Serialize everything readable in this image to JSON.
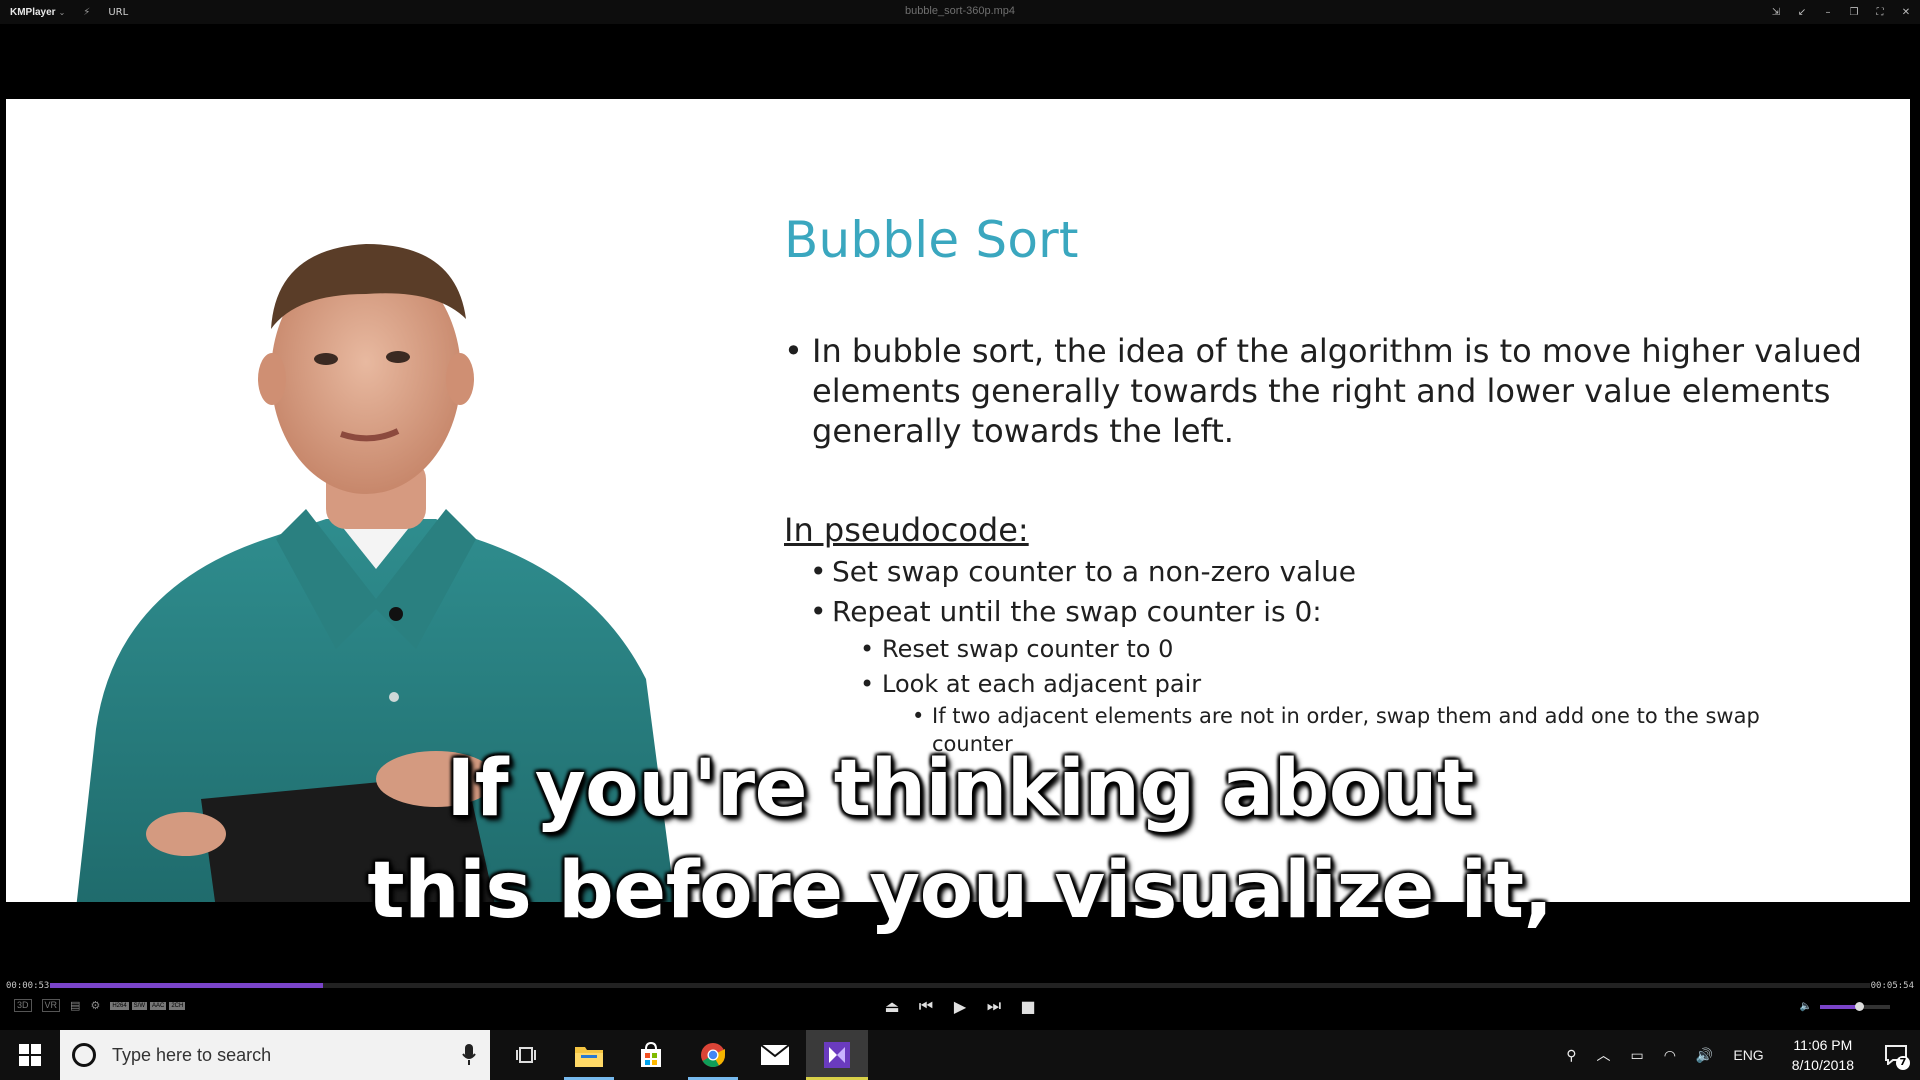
{
  "window": {
    "app_name": "KMPlayer",
    "url_label": "URL",
    "file_title": "bubble_sort-360p.mp4"
  },
  "slide": {
    "title": "Bubble Sort",
    "bullet_main_lines": [
      "In bubble sort, the idea of the algorithm is to move higher valued",
      "elements generally towards the right and lower value elements",
      "generally towards the left."
    ],
    "pseudocode_heading": "In pseudocode:",
    "items": [
      {
        "level": 1,
        "text": "Set swap counter to a non-zero value"
      },
      {
        "level": 1,
        "text": "Repeat until the swap counter is 0:"
      },
      {
        "level": 2,
        "text": "Reset swap counter to 0"
      },
      {
        "level": 2,
        "text": "Look at each adjacent pair"
      },
      {
        "level": 3,
        "text": "If two adjacent elements are not in order, swap them and add one to the swap"
      },
      {
        "level": 3,
        "text": "counter"
      }
    ]
  },
  "subtitle": {
    "line1": "If you're thinking about",
    "line2": "this before you visualize it,"
  },
  "playback": {
    "elapsed": "00:00:53",
    "total": "00:05:54",
    "progress_fraction": 0.15,
    "volume_fraction": 0.55
  },
  "controls": {
    "left_chips": [
      "3D",
      "VR"
    ],
    "codecs": [
      "H264",
      "S/W",
      "AAC",
      "2CH"
    ]
  },
  "taskbar": {
    "search_placeholder": "Type here to search",
    "apps": [
      "task-view",
      "file-explorer",
      "microsoft-store",
      "chrome",
      "mail",
      "kmplayer"
    ],
    "language": "ENG",
    "time": "11:06 PM",
    "date": "8/10/2018",
    "notification_count": "7"
  },
  "colors": {
    "slide_title": "#3aa7bf",
    "accent": "#7a44c9",
    "taskbar_active": "#d8d048"
  }
}
